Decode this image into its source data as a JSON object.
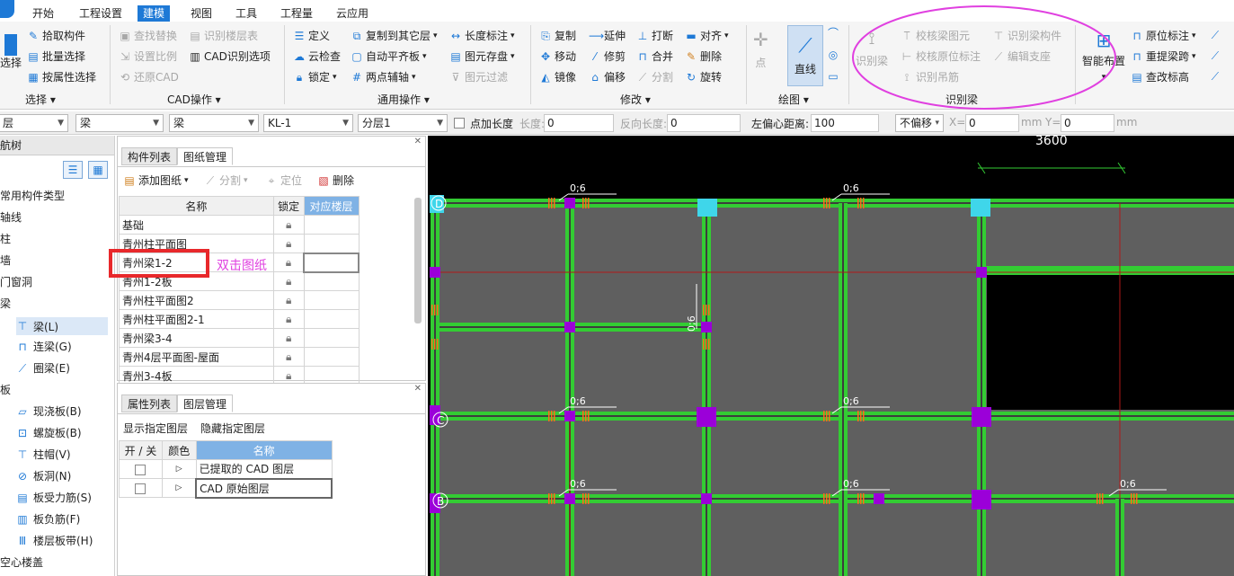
{
  "menu": {
    "tabs": [
      "开始",
      "工程设置",
      "建模",
      "视图",
      "工具",
      "工程量",
      "云应用"
    ],
    "active": "建模"
  },
  "ribbon": {
    "select": {
      "pick": "拾取构件",
      "batch": "批量选择",
      "byattr": "按属性选择",
      "cut_label": "选择",
      "group": "选择 ▾"
    },
    "cad": {
      "find_replace": "查找替换",
      "recog_floor": "识别楼层表",
      "set_scale": "设置比例",
      "cad_options": "CAD识别选项",
      "restore": "还原CAD",
      "group": "CAD操作 ▾"
    },
    "common": {
      "define": "定义",
      "copy_to_floor": "复制到其它层",
      "length_dim": "长度标注",
      "cloud_check": "云检查",
      "auto_align": "自动平齐板",
      "save_element": "图元存盘",
      "lock": "锁定",
      "aux_axis": "两点辅轴",
      "filter": "图元过滤",
      "group": "通用操作 ▾"
    },
    "modify": {
      "copy": "复制",
      "extend": "延伸",
      "break": "打断",
      "align": "对齐",
      "move": "移动",
      "trim": "修剪",
      "merge": "合并",
      "delete": "删除",
      "mirror": "镜像",
      "offset": "偏移",
      "split": "分割",
      "rotate": "旋转",
      "group": "修改 ▾"
    },
    "draw": {
      "point": "点",
      "line": "直线",
      "group": "绘图 ▾"
    },
    "recog_beam": {
      "recog": "识别梁",
      "check_beam": "校核梁图元",
      "recog_member": "识别梁构件",
      "check_orig": "校核原位标注",
      "edit_support": "编辑支座",
      "recog_hanger": "识别吊筋",
      "group": "识别梁"
    },
    "smart": {
      "smart_layout": "智能布置",
      "orig_dim": "原位标注",
      "repick_span": "重提梁跨",
      "change_elev": "查改标高"
    }
  },
  "toolbar": {
    "combo1": "层",
    "combo2": "梁",
    "combo3": "梁",
    "combo4": "KL-1",
    "combo5": "分层1",
    "add_length": "点加长度",
    "length_label": "长度:",
    "length_val": "0",
    "rev_length_label": "反向长度:",
    "rev_length_val": "0",
    "offset_label": "左偏心距离:",
    "offset_val": "100",
    "no_offset": "不偏移",
    "x_label": "X=",
    "x_val": "0",
    "mm1": "mm",
    "y_label": "Y=",
    "y_val": "0",
    "mm2": "mm"
  },
  "leftnav": {
    "title": "航树",
    "items": [
      "常用构件类型",
      "轴线",
      "柱",
      "墙",
      "门窗洞",
      "梁",
      "梁(L)",
      "连梁(G)",
      "圈梁(E)",
      "板",
      "现浇板(B)",
      "螺旋板(B)",
      "柱帽(V)",
      "板洞(N)",
      "板受力筋(S)",
      "板负筋(F)",
      "楼层板带(H)",
      "空心楼盖"
    ]
  },
  "drawings": {
    "tabs": [
      "构件列表",
      "图纸管理"
    ],
    "add": "添加图纸",
    "split": "分割",
    "locate": "定位",
    "delete": "删除",
    "cols": [
      "名称",
      "锁定",
      "对应楼层"
    ],
    "rows": [
      "基础",
      "青州柱平面图",
      "青州梁1-2",
      "青州1-2板",
      "青州柱平面图2",
      "青州柱平面图2-1",
      "青州梁3-4",
      "青州4层平面图-屋面",
      "青州3-4板"
    ],
    "annotation": "双击图纸"
  },
  "layers": {
    "tabs": [
      "属性列表",
      "图层管理"
    ],
    "show": "显示指定图层",
    "hide": "隐藏指定图层",
    "cols": [
      "开 / 关",
      "颜色",
      "名称"
    ],
    "rows": [
      "已提取的 CAD 图层",
      "CAD 原始图层"
    ]
  },
  "canvas": {
    "dim_top": "3600",
    "axis_d": "D",
    "axis_c": "C",
    "axis_b": "B",
    "beam_tag": "0;6"
  },
  "colors": {
    "accent": "#1e79d6",
    "beam": "#33cc33",
    "highlight_red": "#e8282b",
    "ellipse": "#e040e0",
    "canvas_bg": "#000000",
    "slab": "#5f5f5f"
  }
}
